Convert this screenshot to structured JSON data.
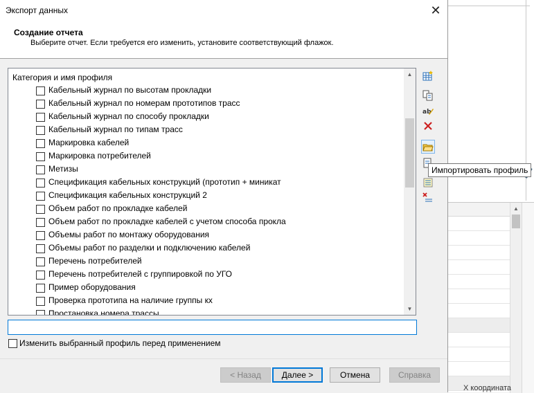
{
  "window": {
    "title": "Экспорт данных",
    "close_glyph": "✕"
  },
  "header": {
    "title": "Создание отчета",
    "subtitle": "Выберите отчет. Если требуется его изменить, установите соответствующий флажок."
  },
  "list": {
    "column_header": "Категория и имя профиля",
    "items": [
      {
        "label": "Кабельный журнал по высотам прокладки",
        "checked": false
      },
      {
        "label": "Кабельный журнал по номерам прототипов трасс",
        "checked": false
      },
      {
        "label": "Кабельный журнал по способу прокладки",
        "checked": false
      },
      {
        "label": "Кабельный журнал по типам трасс",
        "checked": false
      },
      {
        "label": "Маркировка кабелей",
        "checked": false
      },
      {
        "label": "Маркировка потребителей",
        "checked": false
      },
      {
        "label": "Метизы",
        "checked": false
      },
      {
        "label": "Спецификация кабельных конструкций (прототип + миникат",
        "checked": false
      },
      {
        "label": "Спецификация кабельных конструкций 2",
        "checked": false
      },
      {
        "label": "Объем работ по прокладке кабелей",
        "checked": false
      },
      {
        "label": "Объем работ по прокладке кабелей с учетом способа прокла",
        "checked": false
      },
      {
        "label": "Объемы работ по монтажу оборудования",
        "checked": false
      },
      {
        "label": "Объемы работ по разделки и подключению кабелей",
        "checked": false
      },
      {
        "label": "Перечень потребителей",
        "checked": false
      },
      {
        "label": "Перечень потребителей с группировкой по УГО",
        "checked": false
      },
      {
        "label": "Пример оборудования",
        "checked": false
      },
      {
        "label": "Проверка прототипа на наличие группы кх",
        "checked": false
      },
      {
        "label": "Простановка номера трассы",
        "checked": false
      }
    ]
  },
  "toolbar": {
    "tooltip": "Импортировать профиль"
  },
  "profile_name_input": {
    "value": ""
  },
  "modify_checkbox": {
    "label": "Изменить выбранный профиль перед применением",
    "checked": false
  },
  "buttons": {
    "back": "< Назад",
    "next": "Далее >",
    "cancel": "Отмена",
    "help": "Справка"
  },
  "background_app": {
    "bottom_text": "Х координата"
  }
}
